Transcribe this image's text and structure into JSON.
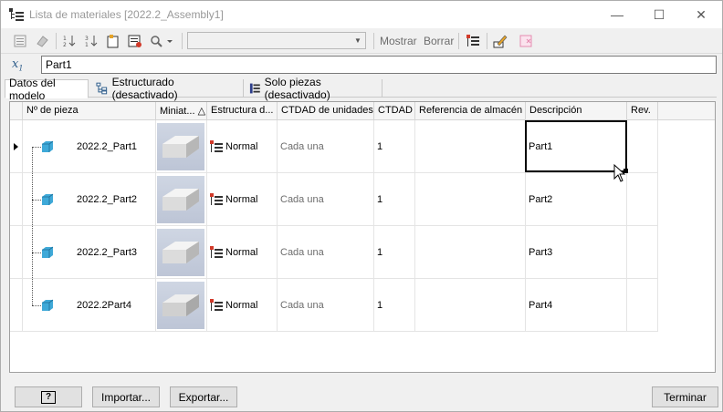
{
  "window": {
    "title": "Lista de materiales [2022.2_Assembly1]",
    "minimize": "—",
    "maximize": "☐",
    "close": "✕"
  },
  "toolbar": {
    "show_label": "Mostrar",
    "clear_label": "Borrar",
    "combo_value": ""
  },
  "formula": {
    "value": "Part1"
  },
  "tabs": [
    {
      "label": "Datos del modelo",
      "active": true
    },
    {
      "label": "Estructurado (desactivado)",
      "active": false
    },
    {
      "label": "Solo piezas (desactivado)",
      "active": false
    }
  ],
  "columns": [
    {
      "label": "Nº de pieza"
    },
    {
      "label": "Miniat... △"
    },
    {
      "label": "Estructura d..."
    },
    {
      "label": "CTDAD de unidades"
    },
    {
      "label": "CTDAD"
    },
    {
      "label": "Referencia de almacén"
    },
    {
      "label": "Descripción"
    },
    {
      "label": "Rev."
    }
  ],
  "rows": [
    {
      "part_number": "2022.2_Part1",
      "structure": "Normal",
      "unit_qty": "Cada una",
      "qty": "1",
      "stock_ref": "",
      "description": "Part1",
      "rev": ""
    },
    {
      "part_number": "2022.2_Part2",
      "structure": "Normal",
      "unit_qty": "Cada una",
      "qty": "1",
      "stock_ref": "",
      "description": "Part2",
      "rev": ""
    },
    {
      "part_number": "2022.2_Part3",
      "structure": "Normal",
      "unit_qty": "Cada una",
      "qty": "1",
      "stock_ref": "",
      "description": "Part3",
      "rev": ""
    },
    {
      "part_number": "2022.2Part4",
      "structure": "Normal",
      "unit_qty": "Cada una",
      "qty": "1",
      "stock_ref": "",
      "description": "Part4",
      "rev": ""
    }
  ],
  "buttons": {
    "help": "?",
    "import": "Importar...",
    "export": "Exportar...",
    "finish": "Terminar"
  },
  "colors": {
    "part_icon": "#3fa9d8",
    "structure_icon_accent": "#d23a2a"
  }
}
